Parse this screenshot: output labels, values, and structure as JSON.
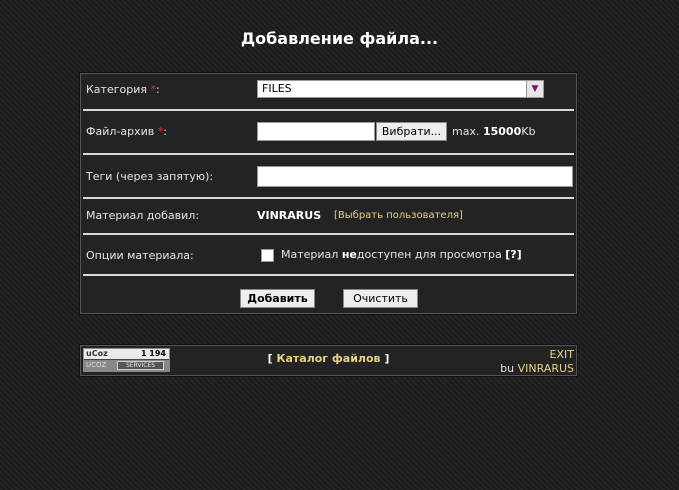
{
  "page": {
    "title": "Добавление файла..."
  },
  "form": {
    "category": {
      "label": "Категория",
      "required_mark": "*",
      "colon": ":",
      "value": "FILES"
    },
    "file": {
      "label": "Файл-архив",
      "required_mark": "*",
      "colon": ":",
      "browse_label": "Вибрати...",
      "max_prefix": "max.",
      "max_value": "15000",
      "max_unit": "Kb"
    },
    "tags": {
      "label": "Теги (через запятую):",
      "value": ""
    },
    "added_by": {
      "label": "Материал добавил:",
      "user": "VINRARUS",
      "pick_link": "[Выбрать пользователя]"
    },
    "options": {
      "label": "Опции материала:",
      "checkbox_checked": false,
      "checkbox_label_pre": "Материал ",
      "checkbox_label_bold": "не",
      "checkbox_label_post": "доступен для просмотра ",
      "help": "[?]"
    },
    "submit_label": "Добавить",
    "reset_label": "Очистить"
  },
  "footer": {
    "ucoz_brand": "uCoz",
    "ucoz_count": "1 194",
    "ucoz_left": "UCOZ",
    "ucoz_right": "SERVICES",
    "catalog_open": "[ ",
    "catalog_label": "Каталог файлов",
    "catalog_close": " ]",
    "exit_label": "EXIT",
    "by_prefix": "bu ",
    "by_user": "VINRARUS"
  },
  "colors": {
    "link": "#e8d08a",
    "required": "#e03030",
    "background": "#1f1f1f"
  }
}
